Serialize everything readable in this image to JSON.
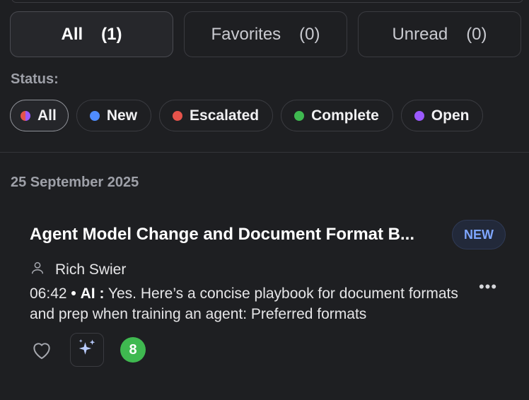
{
  "filter_tabs": [
    {
      "label": "All",
      "count": "(1)"
    },
    {
      "label": "Favorites",
      "count": "(0)"
    },
    {
      "label": "Unread",
      "count": "(0)"
    }
  ],
  "status_filter": {
    "label": "Status:",
    "chips": [
      {
        "label": "All",
        "color": "gradient-red-purple"
      },
      {
        "label": "New",
        "color": "#4f8cff"
      },
      {
        "label": "Escalated",
        "color": "#e5534b"
      },
      {
        "label": "Complete",
        "color": "#3fb950"
      },
      {
        "label": "Open",
        "color": "#9b59ff"
      }
    ]
  },
  "date_group": "25 September 2025",
  "conversation": {
    "title": "Agent Model Change and Document Format B...",
    "badge": "NEW",
    "author": "Rich Swier",
    "time": "06:42",
    "separator": "•",
    "sender": "AI :",
    "preview": "Yes. Here’s a concise playbook for document formats and prep when training an agent: Preferred formats",
    "more": "•••",
    "message_count": "8",
    "icons": [
      "person-icon",
      "heart-icon",
      "sparkles-icon"
    ]
  }
}
